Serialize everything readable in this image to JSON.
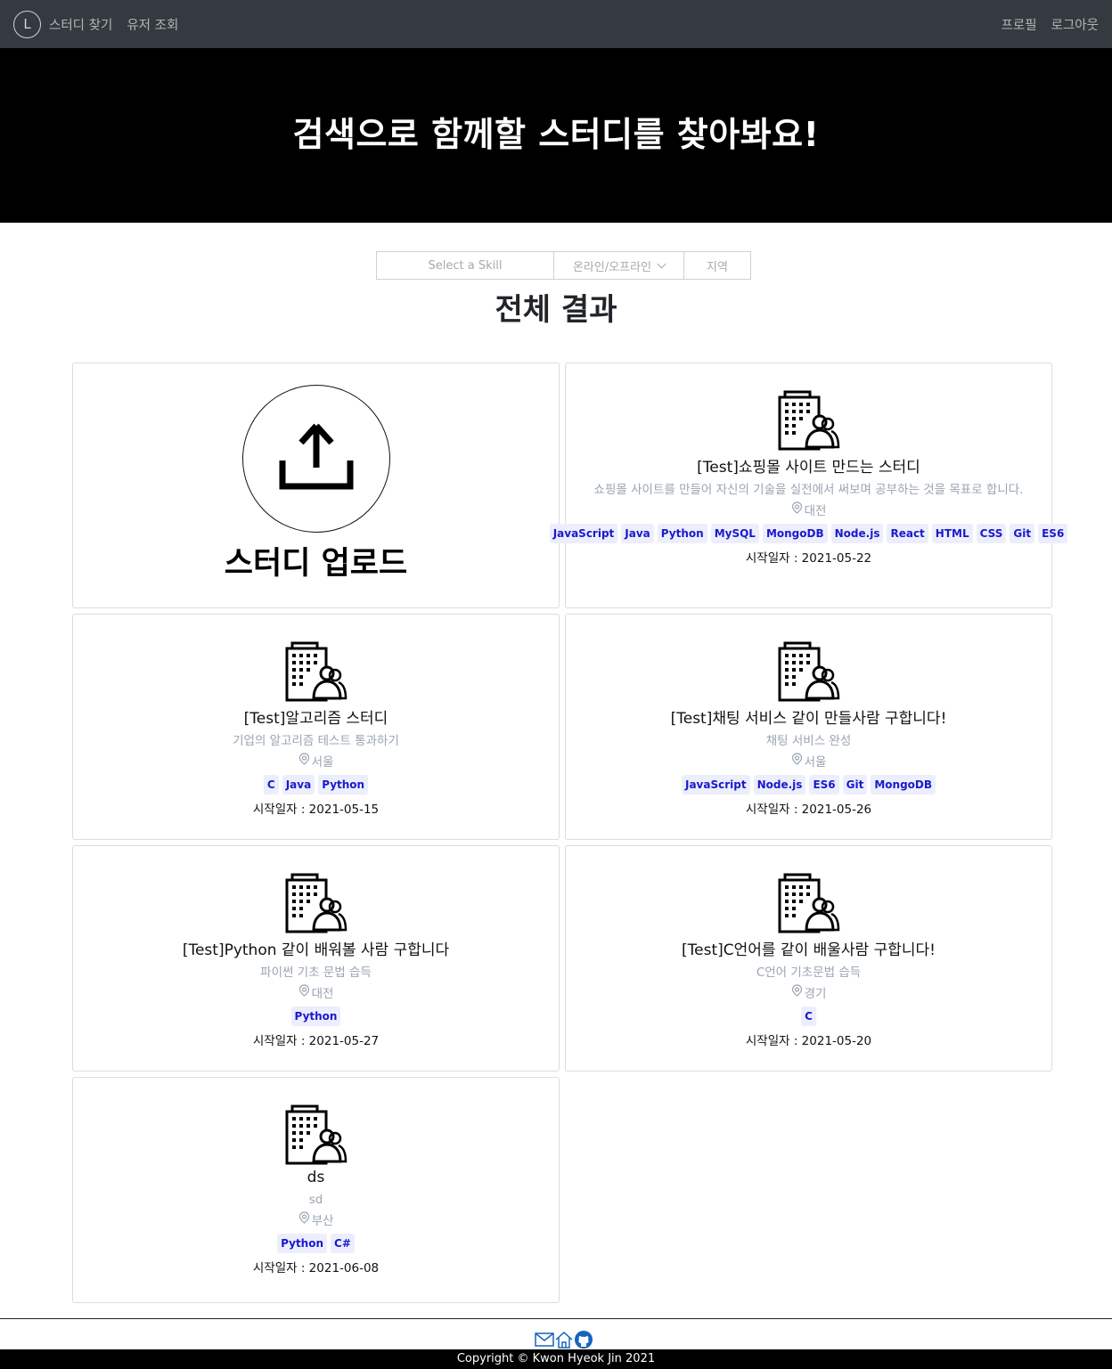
{
  "nav": {
    "logo_letter": "L",
    "links": [
      "스터디 찾기",
      "유저 조회"
    ],
    "right_links": [
      "프로필",
      "로그아웃"
    ]
  },
  "hero": {
    "title": "검색으로 함께할 스터디를 찾아봐요!"
  },
  "filters": {
    "skill_placeholder": "Select a Skill",
    "online_label": "온라인/오프라인",
    "region_label": "지역"
  },
  "results_title": "전체 결과",
  "upload": {
    "label": "스터디 업로드"
  },
  "date_prefix": "시작일자 : ",
  "studies": [
    {
      "title": "[Test]쇼핑몰 사이트 만드는 스터디",
      "desc": "쇼핑몰 사이트를 만들어 자신의 기술을 실전에서 써보며 공부하는 것을 목표로 합니다.",
      "location": "대전",
      "tags": [
        "JavaScript",
        "Java",
        "Python",
        "MySQL",
        "MongoDB",
        "Node.js",
        "React",
        "HTML",
        "CSS",
        "Git",
        "ES6"
      ],
      "date": "2021-05-22"
    },
    {
      "title": "[Test]알고리즘 스터디",
      "desc": "기업의 알고리즘 테스트 통과하기",
      "location": "서울",
      "tags": [
        "C",
        "Java",
        "Python"
      ],
      "date": "2021-05-15"
    },
    {
      "title": "[Test]채팅 서비스 같이 만들사람 구합니다!",
      "desc": "채팅 서비스 완성",
      "location": "서울",
      "tags": [
        "JavaScript",
        "Node.js",
        "ES6",
        "Git",
        "MongoDB"
      ],
      "date": "2021-05-26"
    },
    {
      "title": "[Test]Python 같이 배워볼 사람 구합니다",
      "desc": "파이썬 기초 문법 습득",
      "location": "대전",
      "tags": [
        "Python"
      ],
      "date": "2021-05-27"
    },
    {
      "title": "[Test]C언어를 같이 배울사람 구합니다!",
      "desc": "C언어 기초문법 습득",
      "location": "경기",
      "tags": [
        "C"
      ],
      "date": "2021-05-20"
    },
    {
      "title": "ds",
      "desc": "sd",
      "location": "부산",
      "tags": [
        "Python",
        "C#"
      ],
      "date": "2021-06-08"
    }
  ],
  "footer": {
    "copyright": "Copyright © Kwon Hyeok Jin 2021"
  },
  "colors": {
    "nav_bg": "#343a40",
    "hero_bg": "#000000",
    "tag_bg": "#eceefc",
    "tag_text": "#1a1acc"
  }
}
